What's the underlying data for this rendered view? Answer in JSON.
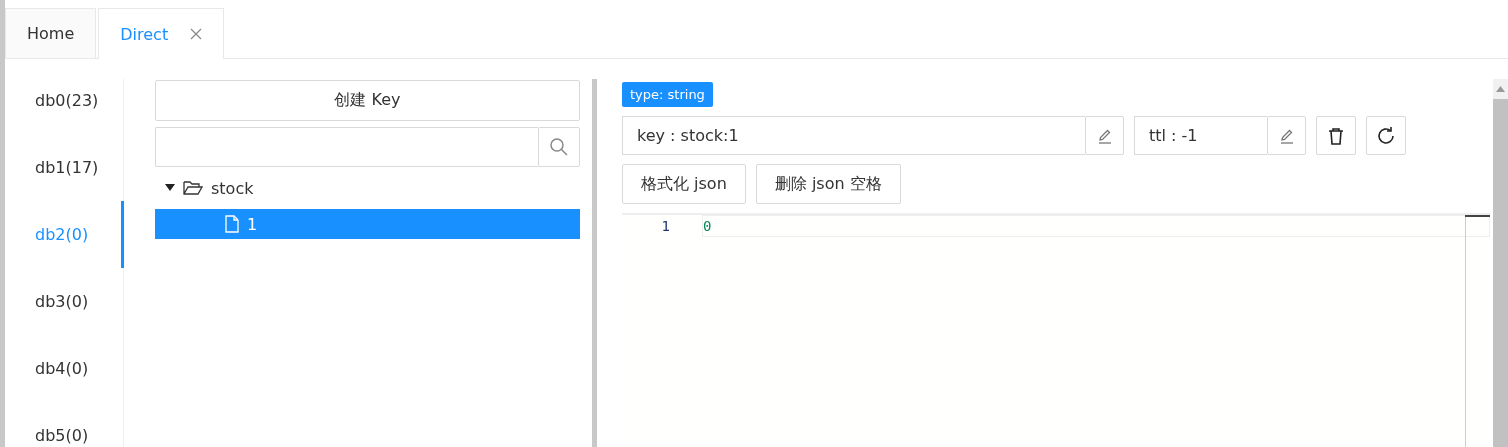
{
  "tabs": [
    {
      "label": "Home",
      "selected": false,
      "closable": false
    },
    {
      "label": "Direct",
      "selected": true,
      "closable": true
    }
  ],
  "databases": [
    {
      "label": "db0(23)",
      "selected": false
    },
    {
      "label": "db1(17)",
      "selected": false
    },
    {
      "label": "db2(0)",
      "selected": true
    },
    {
      "label": "db3(0)",
      "selected": false
    },
    {
      "label": "db4(0)",
      "selected": false
    },
    {
      "label": "db5(0)",
      "selected": false
    }
  ],
  "create_key_button": "创建 Key",
  "key_tree": [
    {
      "label": "stock",
      "expanded": true,
      "children": [
        {
          "label": "1",
          "selected": true
        }
      ]
    }
  ],
  "type_badge": "type: string",
  "key_field": {
    "value": "key : stock:1"
  },
  "ttl_field": {
    "value": "ttl : -1"
  },
  "format_buttons": [
    "格式化 json",
    "删除 json 空格"
  ],
  "editor": {
    "lines": [
      {
        "number": "1",
        "text": "0"
      }
    ]
  }
}
